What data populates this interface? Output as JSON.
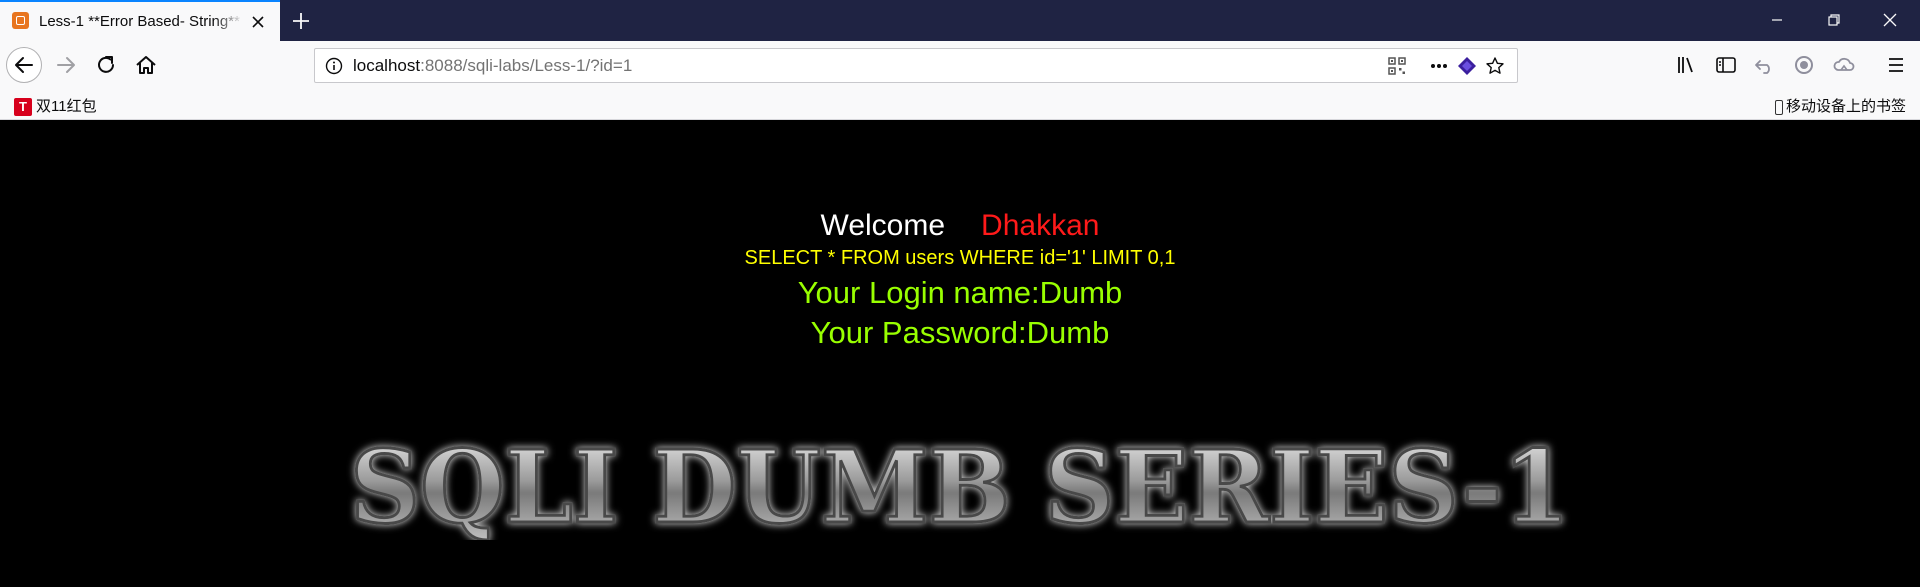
{
  "browser": {
    "tab": {
      "title": "Less-1 **Error Based- String**"
    },
    "url": {
      "host": "localhost",
      "rest": ":8088/sqli-labs/Less-1/?id=1"
    },
    "bookmarks": {
      "left": "双11红包",
      "left_icon_letter": "T",
      "right": "移动设备上的书签"
    },
    "icons": {
      "tab_favicon": "xampp-icon",
      "tab_close": "close-icon",
      "new_tab": "plus-icon",
      "minimize": "minimize-icon",
      "restore": "restore-icon",
      "close_window": "close-icon",
      "back": "back-arrow-icon",
      "forward": "forward-arrow-icon",
      "reload": "reload-icon",
      "home": "home-icon",
      "site_info": "info-icon",
      "qr": "qr-code-icon",
      "page_actions": "more-icon",
      "extension": "extension-icon",
      "bookmark_star": "star-icon",
      "library": "library-icon",
      "sidebar": "sidebar-icon",
      "undo": "undo-icon",
      "record": "record-icon",
      "cloud": "cloud-icon",
      "menu": "hamburger-menu-icon"
    }
  },
  "page": {
    "welcome": "Welcome",
    "name": "Dhakkan",
    "query": "SELECT * FROM users WHERE id='1' LIMIT 0,1",
    "login": "Your Login name:Dumb",
    "password": "Your Password:Dumb",
    "banner": "SQLI DUMB SERIES-1"
  },
  "colors": {
    "tabstrip": "#1f2343",
    "accent": "#0a84ff",
    "welcome": "#ffffff",
    "name": "#ff1a1a",
    "query": "#ffff00",
    "credentials": "#99ff00",
    "page_bg": "#000000"
  }
}
